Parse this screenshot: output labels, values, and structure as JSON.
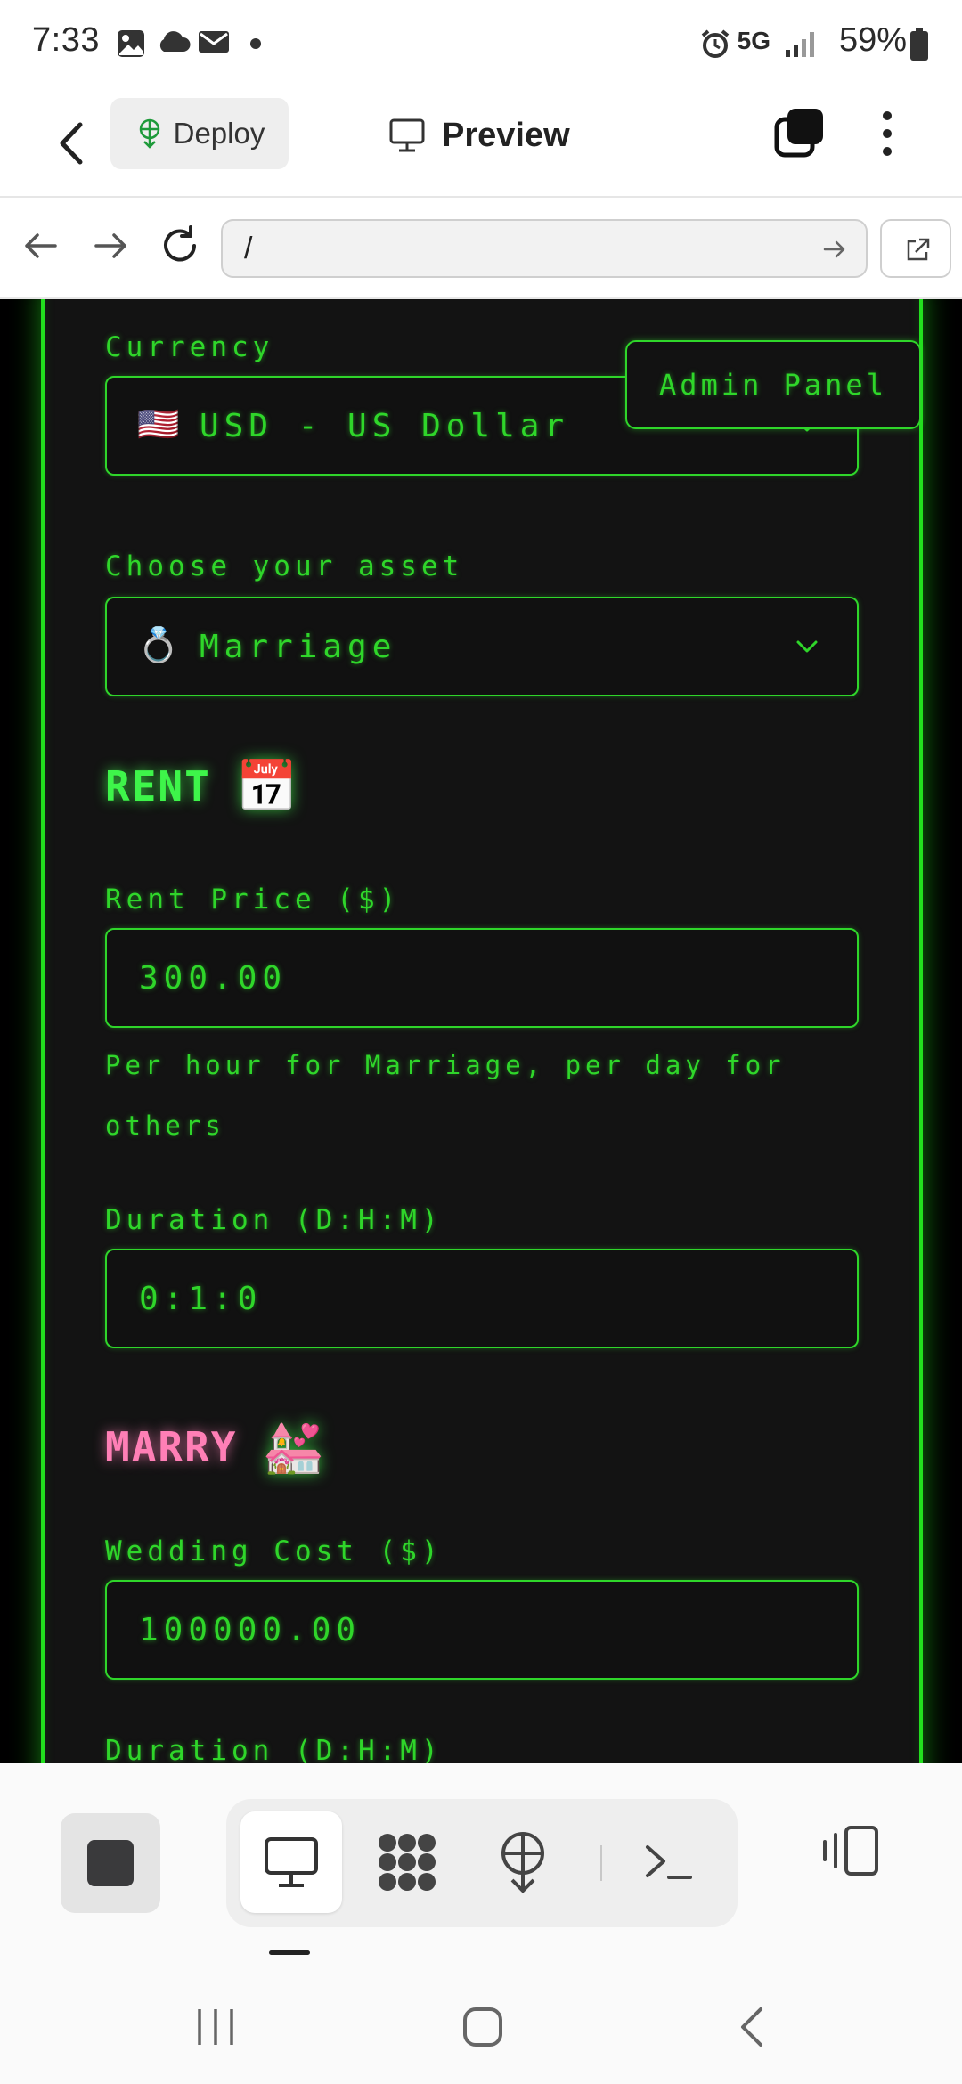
{
  "status_bar": {
    "time": "7:33",
    "network": "5G",
    "battery": "59%",
    "icons": [
      "gallery-icon",
      "cloud-icon",
      "mail-icon",
      "dot-icon",
      "alarm-icon",
      "signal-icon",
      "battery-icon"
    ]
  },
  "toolbar": {
    "deploy_label": "Deploy",
    "preview_label": "Preview"
  },
  "url_bar": {
    "url": "/"
  },
  "page": {
    "admin_panel_label": "Admin Panel",
    "currency": {
      "label": "Currency",
      "flag": "🇺🇸",
      "value": "USD - US Dollar"
    },
    "asset": {
      "label": "Choose your asset",
      "emoji": "💍",
      "value": "Marriage"
    },
    "rent": {
      "heading": "RENT",
      "emoji": "📅",
      "price_label": "Rent Price ($)",
      "price_value": "300.00",
      "helper": "Per hour for Marriage, per day for others",
      "duration_label": "Duration (D:H:M)",
      "duration_value": "0:1:0"
    },
    "marry": {
      "heading": "MARRY",
      "emoji": "💒",
      "cost_label": "Wedding Cost ($)",
      "cost_value": "100000.00",
      "duration_label": "Duration (D:H:M)"
    }
  },
  "colors": {
    "neon_green": "#2fd62a",
    "frame_green": "#22e01e",
    "marry_pink": "#ff7fb6",
    "panel_bg": "#131313"
  }
}
